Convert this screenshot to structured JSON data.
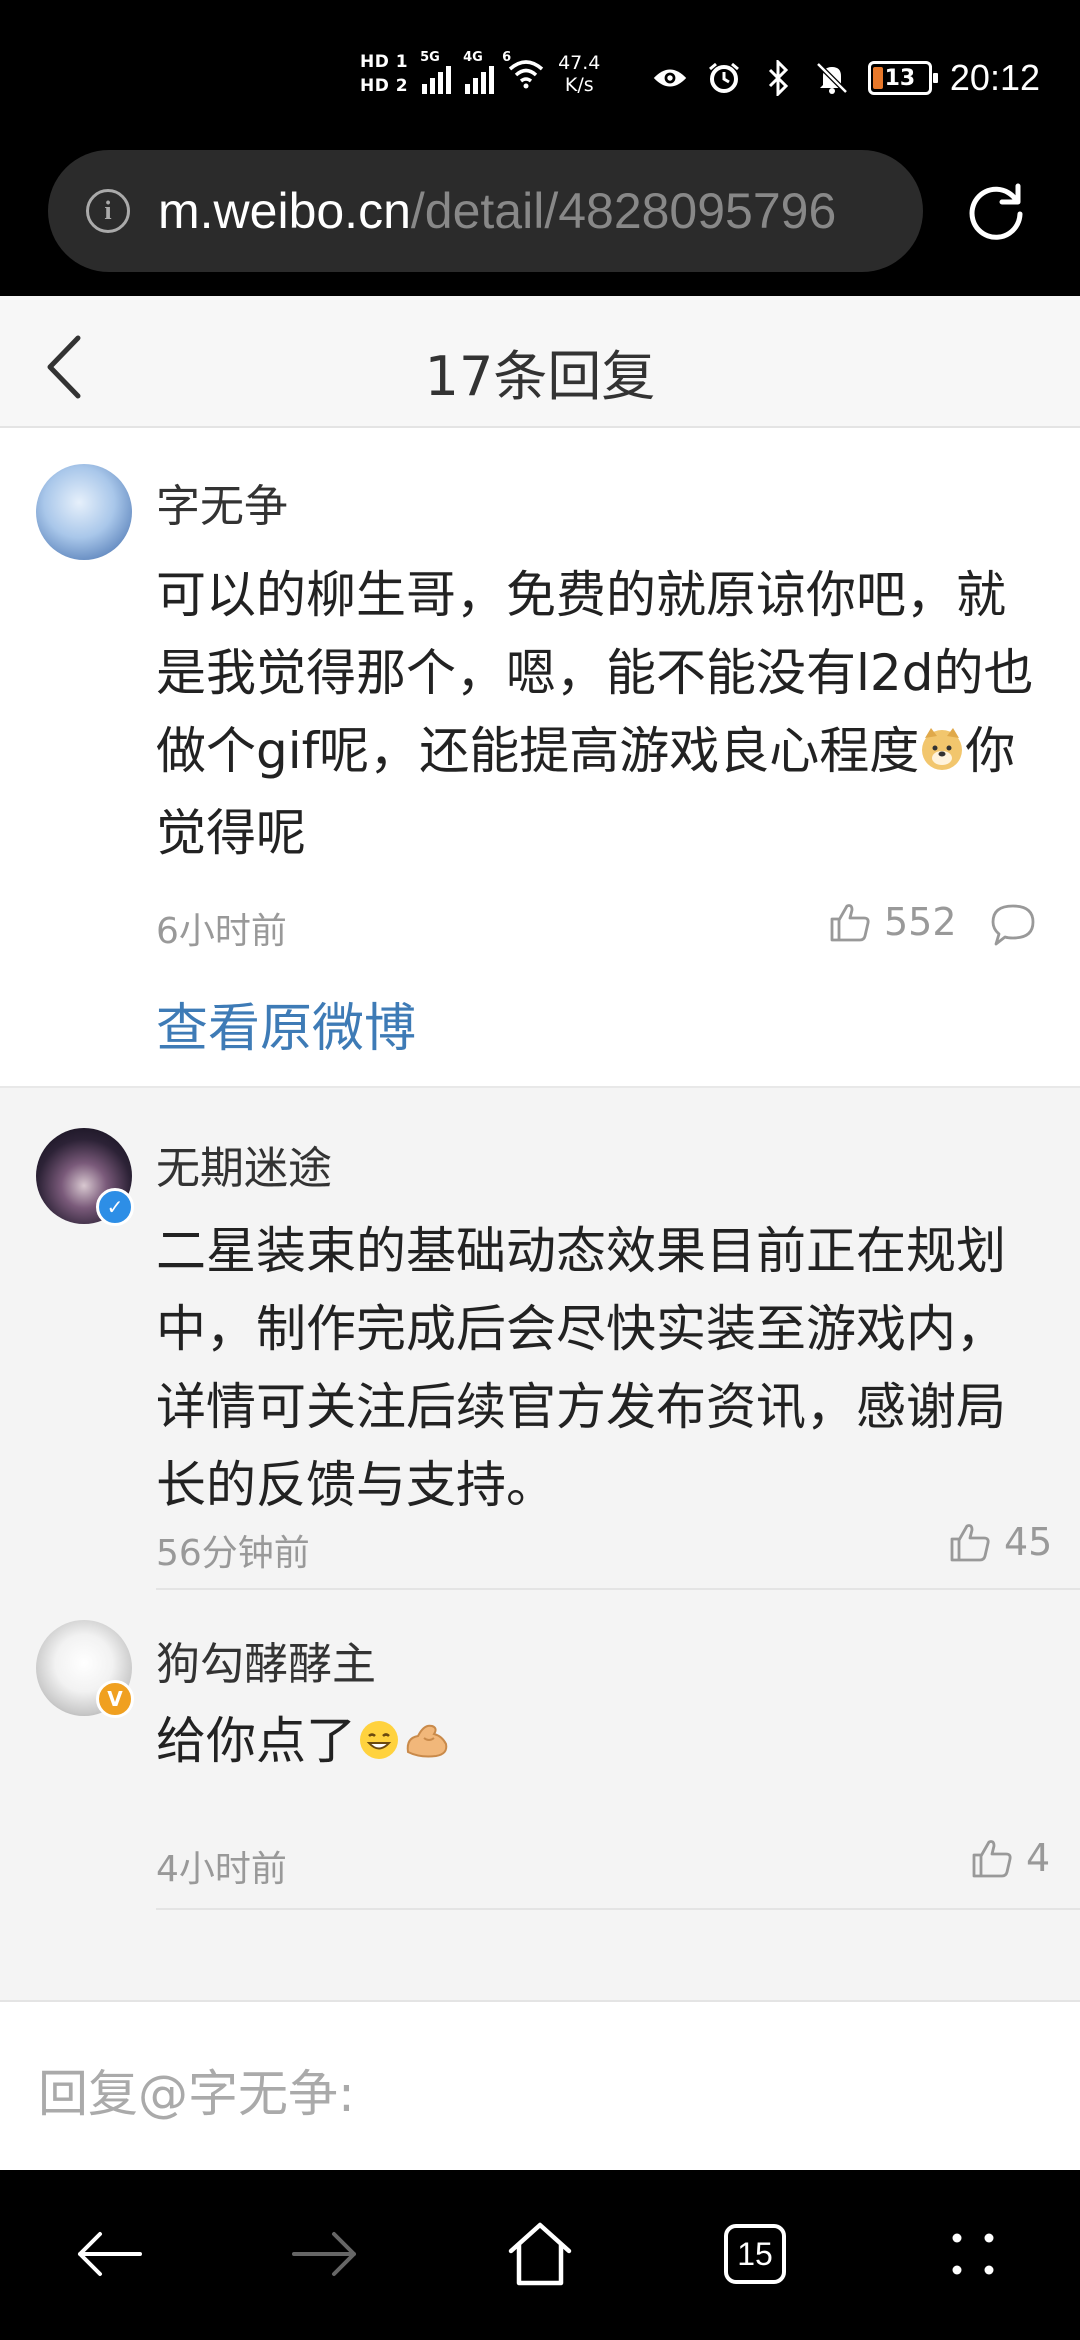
{
  "status_bar": {
    "hd1": "HD 1",
    "hd2": "HD 2",
    "sig1_label": "5G",
    "sig2_label": "4G",
    "wifi_label": "6",
    "net_speed_value": "47.4",
    "net_speed_unit": "K/s",
    "battery": "13",
    "time": "20:12"
  },
  "browser": {
    "url_host": "m.weibo.cn",
    "url_path": "/detail/4828095796"
  },
  "header": {
    "title": "17条回复"
  },
  "main_comment": {
    "author": "字无争",
    "text_before_emoji": "可以的柳生哥，免费的就原谅你吧，就是我觉得那个，嗯，能不能没有l2d的也做个gif呢，还能提高游戏良心程度",
    "text_after_emoji": "你觉得呢",
    "time": "6小时前",
    "likes": "552",
    "view_original": "查看原微博"
  },
  "replies": [
    {
      "author": "无期迷途",
      "verified_color": "#2d8ee6",
      "text": "二星装束的基础动态效果目前正在规划中，制作完成后会尽快实装至游戏内，详情可关注后续官方发布资讯，感谢局长的反馈与支持。",
      "time": "56分钟前",
      "likes": "45"
    },
    {
      "author": "狗勾酵酵主",
      "verified_color": "#f0a020",
      "text": "给你点了",
      "time": "4小时前",
      "likes": "4"
    }
  ],
  "reply_input": {
    "placeholder": "回复@字无争:"
  },
  "navbar": {
    "tabs_count": "15"
  },
  "colors": {
    "link_blue": "#3e7bb6",
    "verified_blue": "#2d8ee6",
    "verified_gold": "#f0a020"
  }
}
